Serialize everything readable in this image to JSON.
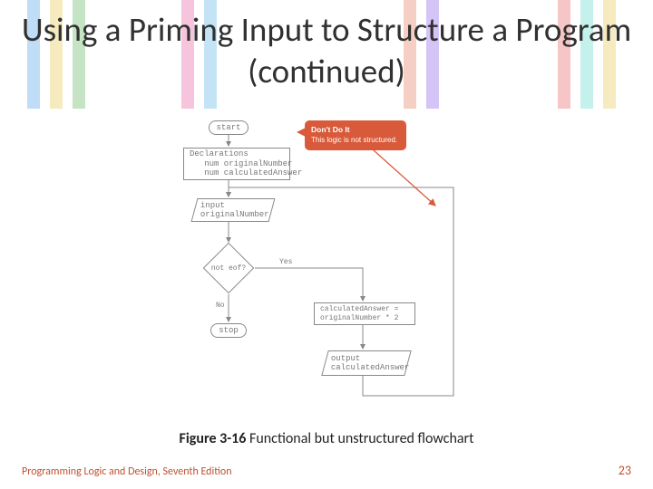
{
  "title": "Using a Priming Input to Structure a Program (continued)",
  "flow": {
    "start": "start",
    "declarations": "Declarations\n   num originalNumber\n   num calculatedAnswer",
    "input1": "input\noriginalNumber",
    "decision": "not eof?",
    "yes": "Yes",
    "no": "No",
    "stop": "stop",
    "calc": "calculatedAnswer =\noriginalNumber * 2",
    "output": "output\ncalculatedAnswer",
    "callout_head": "Don't Do It",
    "callout_body": "This logic is not structured."
  },
  "caption_bold": "Figure 3-16",
  "caption_rest": " Functional but unstructured flowchart",
  "footer_left": "Programming Logic and Design, Seventh Edition",
  "footer_right": "23",
  "chart_data": {
    "type": "diagram",
    "flowchart": {
      "nodes": [
        {
          "id": "start",
          "type": "terminal",
          "label": "start"
        },
        {
          "id": "decl",
          "type": "process",
          "label": "Declarations\n   num originalNumber\n   num calculatedAnswer"
        },
        {
          "id": "in1",
          "type": "io",
          "label": "input originalNumber"
        },
        {
          "id": "eof",
          "type": "decision",
          "label": "not eof?"
        },
        {
          "id": "stop",
          "type": "terminal",
          "label": "stop"
        },
        {
          "id": "calc",
          "type": "process",
          "label": "calculatedAnswer = originalNumber * 2"
        },
        {
          "id": "out",
          "type": "io",
          "label": "output calculatedAnswer"
        }
      ],
      "edges": [
        {
          "from": "start",
          "to": "decl"
        },
        {
          "from": "decl",
          "to": "in1"
        },
        {
          "from": "in1",
          "to": "eof"
        },
        {
          "from": "eof",
          "to": "stop",
          "label": "No"
        },
        {
          "from": "eof",
          "to": "calc",
          "label": "Yes"
        },
        {
          "from": "calc",
          "to": "out"
        },
        {
          "from": "out",
          "to": "in1",
          "note": "loops back above input"
        }
      ],
      "annotation": {
        "target": "out-to-in1 loop",
        "text": "Don't Do It — This logic is not structured."
      }
    }
  }
}
